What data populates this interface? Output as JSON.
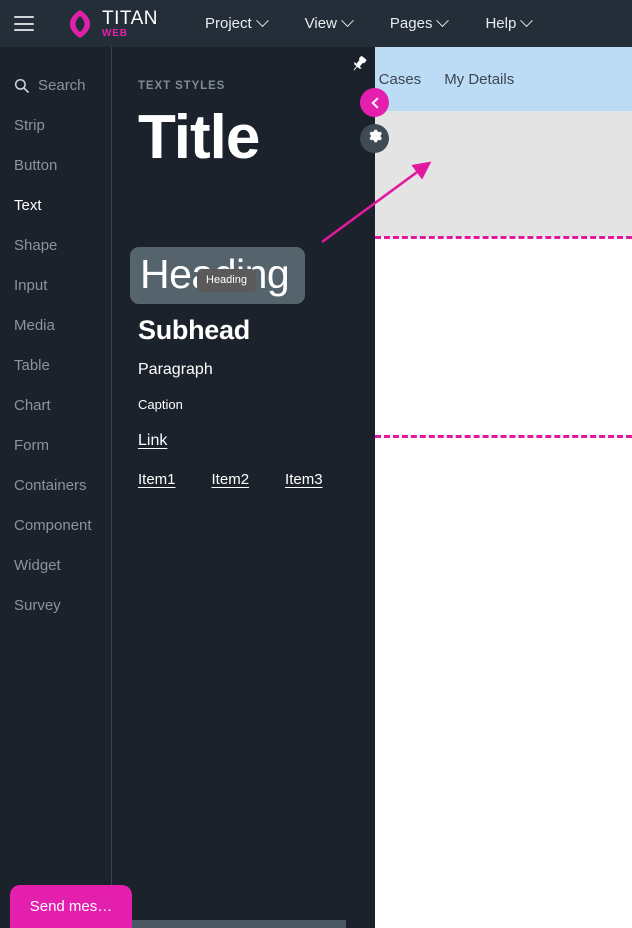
{
  "app": {
    "brand_title": "TITAN",
    "brand_sub": "WEB",
    "accent": "#e41fae",
    "topbar_bg": "#242e38",
    "panel_bg": "#1b222b"
  },
  "topbar": {
    "menus": [
      {
        "label": "Project",
        "icon": "chevron-down-icon"
      },
      {
        "label": "View",
        "icon": "chevron-down-icon"
      },
      {
        "label": "Pages",
        "icon": "chevron-down-icon"
      },
      {
        "label": "Help",
        "icon": "chevron-down-icon"
      }
    ],
    "hamburger_icon": "hamburger-icon",
    "logo_icon": "titan-logo-icon"
  },
  "sidebar": {
    "search": {
      "placeholder": "Search",
      "icon": "search-icon"
    },
    "items": [
      {
        "label": "Strip",
        "active": false
      },
      {
        "label": "Button",
        "active": false
      },
      {
        "label": "Text",
        "active": true
      },
      {
        "label": "Shape",
        "active": false
      },
      {
        "label": "Input",
        "active": false
      },
      {
        "label": "Media",
        "active": false
      },
      {
        "label": "Table",
        "active": false
      },
      {
        "label": "Chart",
        "active": false
      },
      {
        "label": "Form",
        "active": false
      },
      {
        "label": "Containers",
        "active": false
      },
      {
        "label": "Component",
        "active": false
      },
      {
        "label": "Widget",
        "active": false
      },
      {
        "label": "Survey",
        "active": false
      }
    ]
  },
  "panel": {
    "title": "TEXT STYLES",
    "styles": {
      "title": "Title",
      "heading": "Heading",
      "subhead": "Subhead",
      "paragraph": "Paragraph",
      "caption": "Caption",
      "link": "Link"
    },
    "list_items": [
      "Item1",
      "Item2",
      "Item3"
    ],
    "drag_badge": "Heading"
  },
  "canvas": {
    "nav_links": [
      "y Cases",
      "My Details"
    ],
    "heading_text": "Heading",
    "nav_bg": "#bcdcf5",
    "band_bg": "#e4e4e4",
    "selection_bg": "#67727a",
    "guide_color": "#e2199f"
  },
  "controls": {
    "pin": {
      "icon": "pin-icon",
      "label": "Pin panel"
    },
    "collapse": {
      "icon": "chevron-left-icon",
      "label": "Collapse panel"
    },
    "settings": {
      "icon": "gear-icon",
      "label": "Settings"
    }
  },
  "footer": {
    "send_label": "Send mes…"
  }
}
